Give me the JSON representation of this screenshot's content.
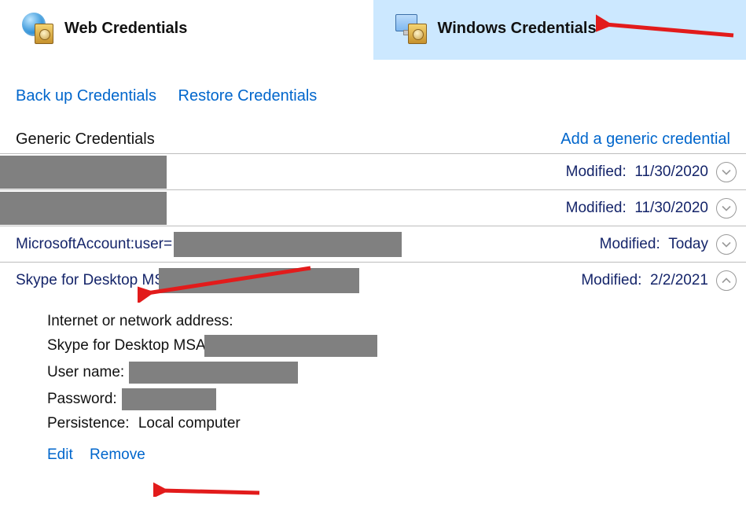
{
  "tabs": {
    "web": "Web Credentials",
    "windows": "Windows Credentials"
  },
  "top_links": {
    "backup": "Back up Credentials",
    "restore": "Restore Credentials"
  },
  "section": {
    "title": "Generic Credentials",
    "add": "Add a generic credential"
  },
  "rows": [
    {
      "name": "",
      "modified_label": "Modified:",
      "modified_value": "11/30/2020",
      "expanded": false
    },
    {
      "name": "",
      "modified_label": "Modified:",
      "modified_value": "11/30/2020",
      "expanded": false
    },
    {
      "name": "MicrosoftAccount:user=",
      "modified_label": "Modified:",
      "modified_value": "Today",
      "expanded": false
    },
    {
      "name": "Skype for Desktop MSA",
      "modified_label": "Modified:",
      "modified_value": "2/2/2021",
      "expanded": true
    }
  ],
  "details": {
    "address_label": "Internet or network address:",
    "address_value": "Skype for Desktop MSA",
    "username_label": "User name:",
    "password_label": "Password:",
    "persistence_label": "Persistence:",
    "persistence_value": "Local computer",
    "edit": "Edit",
    "remove": "Remove"
  }
}
